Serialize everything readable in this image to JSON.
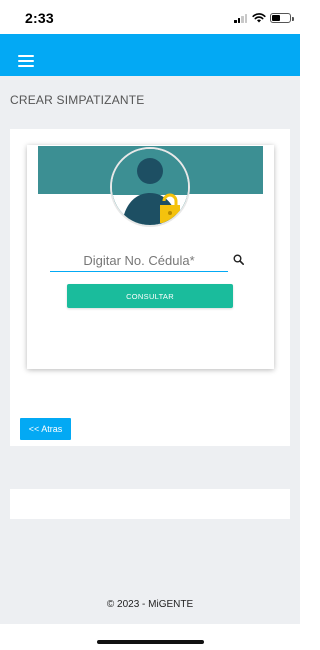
{
  "status_bar": {
    "time": "2:33"
  },
  "app_bar": {
    "menu_icon": "menu-icon",
    "color": "#03a9f4"
  },
  "page": {
    "title": "CREAR SIMPATIZANTE"
  },
  "form": {
    "cedula_placeholder": "Digitar No. Cédula*",
    "cedula_value": "",
    "search_icon": "search-icon",
    "consultar_label": "CONSULTAR",
    "consultar_color": "#1abc9c",
    "banner_color": "#3c8f93",
    "avatar_icon": "user-lock-icon"
  },
  "nav": {
    "back_label": "<< Atras"
  },
  "footer": {
    "copyright": "© 2023 - MiGENTE"
  }
}
